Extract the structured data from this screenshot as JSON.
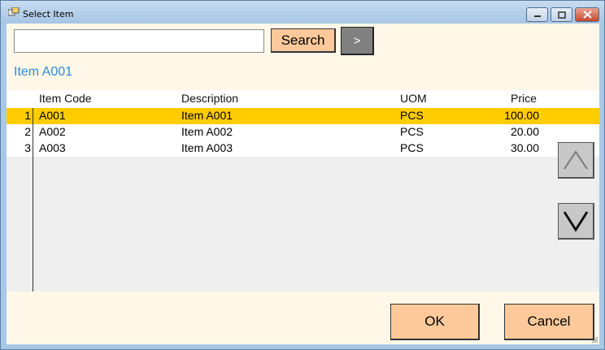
{
  "window": {
    "title": "Select Item",
    "icons": {
      "app": "window-app-icon",
      "minimize": "minimize-icon",
      "maximize": "maximize-icon",
      "close": "close-icon"
    }
  },
  "search": {
    "value": "",
    "placeholder": "",
    "button_label": "Search",
    "go_label": ">"
  },
  "selected_item": "Item A001",
  "grid": {
    "columns": [
      "Item Code",
      "Description",
      "UOM",
      "Price"
    ],
    "rows": [
      {
        "num": "1",
        "code": "A001",
        "description": "Item A001",
        "uom": "PCS",
        "price": "100.00",
        "selected": true
      },
      {
        "num": "2",
        "code": "A002",
        "description": "Item A002",
        "uom": "PCS",
        "price": "20.00",
        "selected": false
      },
      {
        "num": "3",
        "code": "A003",
        "description": "Item A003",
        "uom": "PCS",
        "price": "30.00",
        "selected": false
      }
    ]
  },
  "scroll": {
    "up_icon": "chevron-up-icon",
    "down_icon": "chevron-down-icon"
  },
  "actions": {
    "ok_label": "OK",
    "cancel_label": "Cancel"
  },
  "colors": {
    "accent": "#fdc99b",
    "selection": "#ffcc00",
    "background": "#fff8e9",
    "label": "#2e8bd3"
  }
}
